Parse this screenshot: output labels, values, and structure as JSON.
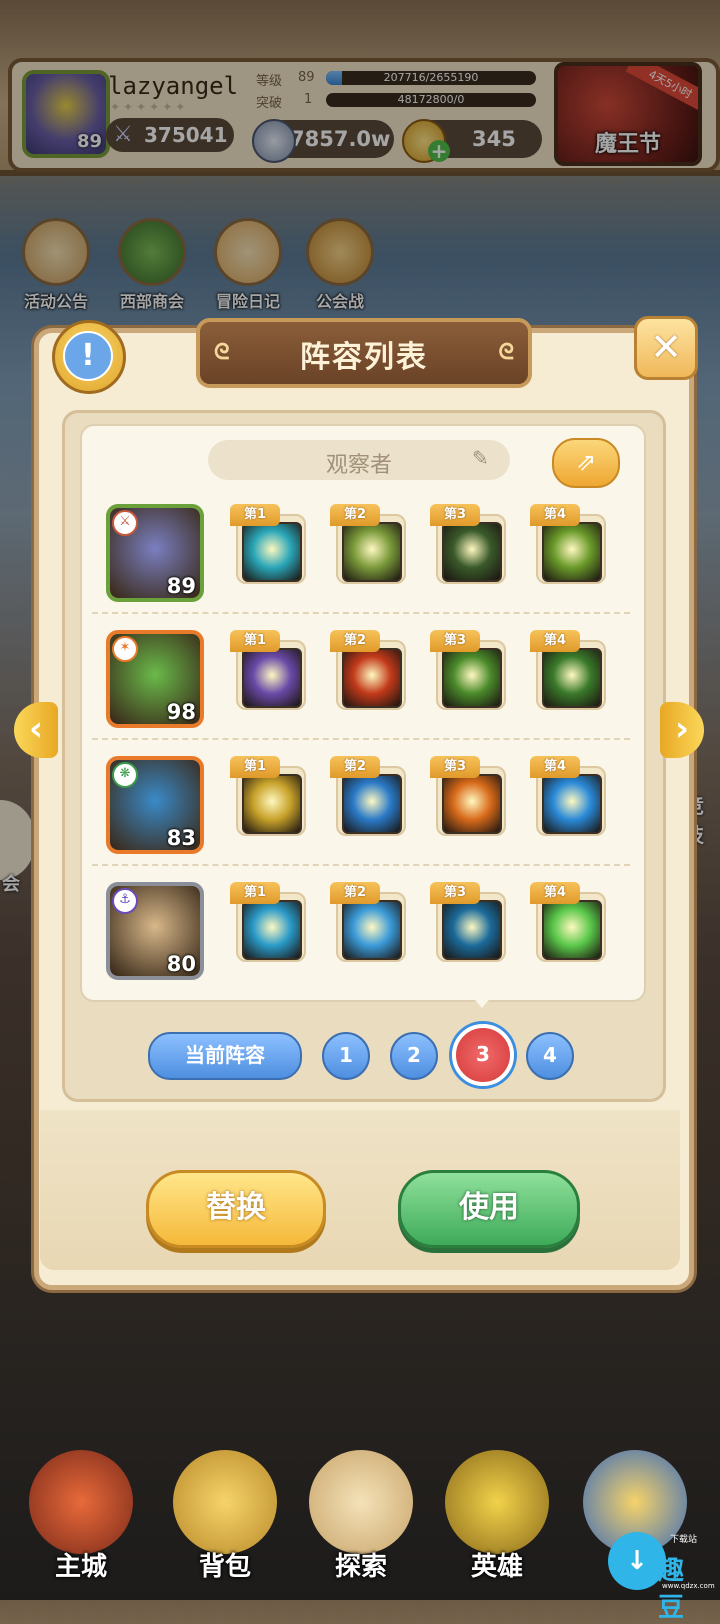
{
  "player": {
    "name": "lazyangel",
    "avatar_level": "89",
    "power": "375041",
    "level_label": "等级",
    "level_value": "89",
    "level_exp_text": "207716/2655190",
    "level_progress": 0.078,
    "break_label": "突破",
    "break_value": "1",
    "break_exp_text": "48172800/0",
    "break_progress": 0.0
  },
  "currency": {
    "silver": "7857.0w",
    "gold": "345",
    "gold_add_icon": "plus-icon"
  },
  "event": {
    "label": "魔王节",
    "tag": "4天5小时"
  },
  "shortcuts": [
    {
      "label": "活动公告",
      "icon": "notice-board-icon"
    },
    {
      "label": "西部商会",
      "icon": "merchant-icon"
    },
    {
      "label": "冒险日记",
      "icon": "diary-icon"
    },
    {
      "label": "公会战",
      "icon": "guild-shield-icon"
    }
  ],
  "modal": {
    "title": "阵容列表",
    "team_name": "观察者",
    "edit_icon": "edit-icon",
    "share_icon": "share-icon",
    "info_icon": "!",
    "close_icon": "✕"
  },
  "lineup": [
    {
      "hero_level": "89",
      "hero_color": "#7a7fc0",
      "skills": [
        {
          "tag": "第1",
          "color": "#2aa6b8"
        },
        {
          "tag": "第2",
          "color": "#7a9a3a"
        },
        {
          "tag": "第3",
          "color": "#3a5a2a"
        },
        {
          "tag": "第4",
          "color": "#6a9a2a"
        }
      ]
    },
    {
      "hero_level": "98",
      "hero_color": "#6aba4a",
      "skills": [
        {
          "tag": "第1",
          "color": "#6a4aa8"
        },
        {
          "tag": "第2",
          "color": "#c23a1a"
        },
        {
          "tag": "第3",
          "color": "#4a8a2a"
        },
        {
          "tag": "第4",
          "color": "#3a7a2a"
        }
      ]
    },
    {
      "hero_level": "83",
      "hero_color": "#3a8ac8",
      "skills": [
        {
          "tag": "第1",
          "color": "#c8a22a"
        },
        {
          "tag": "第2",
          "color": "#2a7ac8"
        },
        {
          "tag": "第3",
          "color": "#d86a1a"
        },
        {
          "tag": "第4",
          "color": "#2a8ad8"
        }
      ]
    },
    {
      "hero_level": "80",
      "hero_color": "#d8b88a",
      "skills": [
        {
          "tag": "第1",
          "color": "#2a9ac8"
        },
        {
          "tag": "第2",
          "color": "#3a9ad8"
        },
        {
          "tag": "第3",
          "color": "#1a6a9a"
        },
        {
          "tag": "第4",
          "color": "#5ac84a"
        }
      ]
    }
  ],
  "pager": {
    "current_label": "当前阵容",
    "pages": [
      "1",
      "2",
      "3",
      "4"
    ],
    "active_index": 2
  },
  "actions": {
    "swap": "替换",
    "use": "使用"
  },
  "nav": [
    {
      "label": "主城",
      "icon": "castle-icon"
    },
    {
      "label": "背包",
      "icon": "backpack-icon"
    },
    {
      "label": "探索",
      "icon": "map-icon"
    },
    {
      "label": "英雄",
      "icon": "hero-icon"
    },
    {
      "label": "",
      "icon": "trophy-icon"
    }
  ],
  "side_labels": {
    "left_edge": "会",
    "right_edge": "竞技"
  },
  "watermark": {
    "brand": "趣豆",
    "small": "下载站",
    "url": "www.qdzx.com"
  },
  "colors": {
    "modal_bg": "#f6ecd4",
    "ribbon": "#6a4226",
    "swap_button": "#f5b93a",
    "use_button": "#3eab5a",
    "page_active": "#d63a3a",
    "page_inactive": "#4f8fe0"
  }
}
